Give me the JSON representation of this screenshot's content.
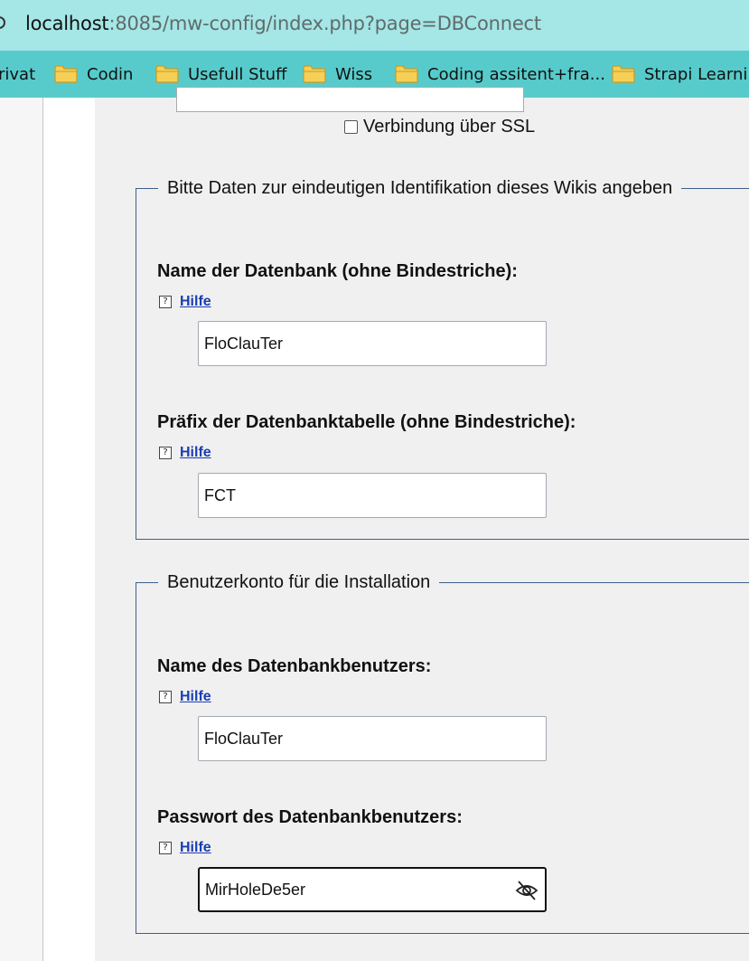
{
  "browser": {
    "url_host": "localhost",
    "url_rest": ":8085/mw-config/index.php?page=DBConnect",
    "bookmarks": [
      {
        "label": "rivat",
        "icon": "folder-icon"
      },
      {
        "label": "Codin",
        "icon": "folder-icon"
      },
      {
        "label": "Usefull Stuff",
        "icon": "folder-icon"
      },
      {
        "label": "Wiss",
        "icon": "folder-icon"
      },
      {
        "label": "Coding assitent+fra...",
        "icon": "folder-icon"
      },
      {
        "label": "Strapi Learning",
        "icon": "folder-icon"
      }
    ]
  },
  "ssl": {
    "label": "Verbindung über SSL",
    "checked": false
  },
  "section_identification": {
    "legend": "Bitte Daten zur eindeutigen Identifikation dieses Wikis angeben",
    "db_name": {
      "label": "Name der Datenbank (ohne Bindestriche):",
      "help": "Hilfe",
      "value": "FloClauTer"
    },
    "db_prefix": {
      "label": "Präfix der Datenbanktabelle (ohne Bindestriche):",
      "help": "Hilfe",
      "value": "FCT"
    }
  },
  "section_account": {
    "legend": "Benutzerkonto für die Installation",
    "db_user": {
      "label": "Name des Datenbankbenutzers:",
      "help": "Hilfe",
      "value": "FloClauTer"
    },
    "db_password": {
      "label": "Passwort des Datenbankbenutzers:",
      "help": "Hilfe",
      "value": "MirHoleDe5er",
      "visibility_icon": "eye-slash-icon"
    }
  },
  "colors": {
    "address_bar": "#a5e6e6",
    "bookmarks_bar": "#57cbcb",
    "fieldset_border": "#3d5f8c",
    "link": "#1a3eb3"
  }
}
